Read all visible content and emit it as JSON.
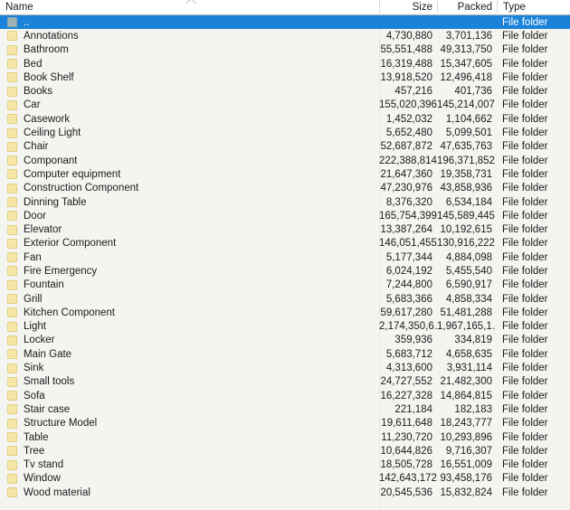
{
  "columns": {
    "name": "Name",
    "size": "Size",
    "packed": "Packed",
    "type": "Type"
  },
  "sort": {
    "column": "Name",
    "direction": "ascending",
    "icon": "chevron-up-icon"
  },
  "icons": {
    "folder": "folder-icon"
  },
  "colors": {
    "selection": "#1a82d8",
    "selection_text": "#ffffff",
    "list_background": "#f4f4f1",
    "header_background": "#ffffff",
    "folder_icon": "#f6e7a6",
    "folder_icon_selected": "#9fb3b5",
    "text": "#1b1b1b",
    "divider": "#e6e6e2"
  },
  "rows": [
    {
      "name": "..",
      "size": "",
      "packed": "",
      "type": "File folder",
      "selected": true
    },
    {
      "name": "Annotations",
      "size": "4,730,880",
      "packed": "3,701,136",
      "type": "File folder",
      "selected": false
    },
    {
      "name": "Bathroom",
      "size": "55,551,488",
      "packed": "49,313,750",
      "type": "File folder",
      "selected": false
    },
    {
      "name": "Bed",
      "size": "16,319,488",
      "packed": "15,347,605",
      "type": "File folder",
      "selected": false
    },
    {
      "name": "Book Shelf",
      "size": "13,918,520",
      "packed": "12,496,418",
      "type": "File folder",
      "selected": false
    },
    {
      "name": "Books",
      "size": "457,216",
      "packed": "401,736",
      "type": "File folder",
      "selected": false
    },
    {
      "name": "Car",
      "size": "155,020,396",
      "packed": "145,214,007",
      "type": "File folder",
      "selected": false
    },
    {
      "name": "Casework",
      "size": "1,452,032",
      "packed": "1,104,662",
      "type": "File folder",
      "selected": false
    },
    {
      "name": "Ceiling Light",
      "size": "5,652,480",
      "packed": "5,099,501",
      "type": "File folder",
      "selected": false
    },
    {
      "name": "Chair",
      "size": "52,687,872",
      "packed": "47,635,763",
      "type": "File folder",
      "selected": false
    },
    {
      "name": "Componant",
      "size": "222,388,814",
      "packed": "196,371,852",
      "type": "File folder",
      "selected": false
    },
    {
      "name": "Computer equipment",
      "size": "21,647,360",
      "packed": "19,358,731",
      "type": "File folder",
      "selected": false
    },
    {
      "name": "Construction Component",
      "size": "47,230,976",
      "packed": "43,858,936",
      "type": "File folder",
      "selected": false
    },
    {
      "name": "Dinning Table",
      "size": "8,376,320",
      "packed": "6,534,184",
      "type": "File folder",
      "selected": false
    },
    {
      "name": "Door",
      "size": "165,754,399",
      "packed": "145,589,445",
      "type": "File folder",
      "selected": false
    },
    {
      "name": "Elevator",
      "size": "13,387,264",
      "packed": "10,192,615",
      "type": "File folder",
      "selected": false
    },
    {
      "name": "Exterior Component",
      "size": "146,051,455",
      "packed": "130,916,222",
      "type": "File folder",
      "selected": false
    },
    {
      "name": "Fan",
      "size": "5,177,344",
      "packed": "4,884,098",
      "type": "File folder",
      "selected": false
    },
    {
      "name": "Fire Emergency",
      "size": "6,024,192",
      "packed": "5,455,540",
      "type": "File folder",
      "selected": false
    },
    {
      "name": "Fountain",
      "size": "7,244,800",
      "packed": "6,590,917",
      "type": "File folder",
      "selected": false
    },
    {
      "name": "Grill",
      "size": "5,683,366",
      "packed": "4,858,334",
      "type": "File folder",
      "selected": false
    },
    {
      "name": "Kitchen Component",
      "size": "59,617,280",
      "packed": "51,481,288",
      "type": "File folder",
      "selected": false
    },
    {
      "name": "Light",
      "size": "2,174,350,6…",
      "packed": "1,967,165,1…",
      "type": "File folder",
      "selected": false
    },
    {
      "name": "Locker",
      "size": "359,936",
      "packed": "334,819",
      "type": "File folder",
      "selected": false
    },
    {
      "name": "Main Gate",
      "size": "5,683,712",
      "packed": "4,658,635",
      "type": "File folder",
      "selected": false
    },
    {
      "name": "Sink",
      "size": "4,313,600",
      "packed": "3,931,114",
      "type": "File folder",
      "selected": false
    },
    {
      "name": "Small tools",
      "size": "24,727,552",
      "packed": "21,482,300",
      "type": "File folder",
      "selected": false
    },
    {
      "name": "Sofa",
      "size": "16,227,328",
      "packed": "14,864,815",
      "type": "File folder",
      "selected": false
    },
    {
      "name": "Stair case",
      "size": "221,184",
      "packed": "182,183",
      "type": "File folder",
      "selected": false
    },
    {
      "name": "Structure Model",
      "size": "19,611,648",
      "packed": "18,243,777",
      "type": "File folder",
      "selected": false
    },
    {
      "name": "Table",
      "size": "11,230,720",
      "packed": "10,293,896",
      "type": "File folder",
      "selected": false
    },
    {
      "name": "Tree",
      "size": "10,644,826",
      "packed": "9,716,307",
      "type": "File folder",
      "selected": false
    },
    {
      "name": "Tv stand",
      "size": "18,505,728",
      "packed": "16,551,009",
      "type": "File folder",
      "selected": false
    },
    {
      "name": "Window",
      "size": "142,643,172",
      "packed": "93,458,176",
      "type": "File folder",
      "selected": false
    },
    {
      "name": "Wood material",
      "size": "20,545,536",
      "packed": "15,832,824",
      "type": "File folder",
      "selected": false
    }
  ]
}
